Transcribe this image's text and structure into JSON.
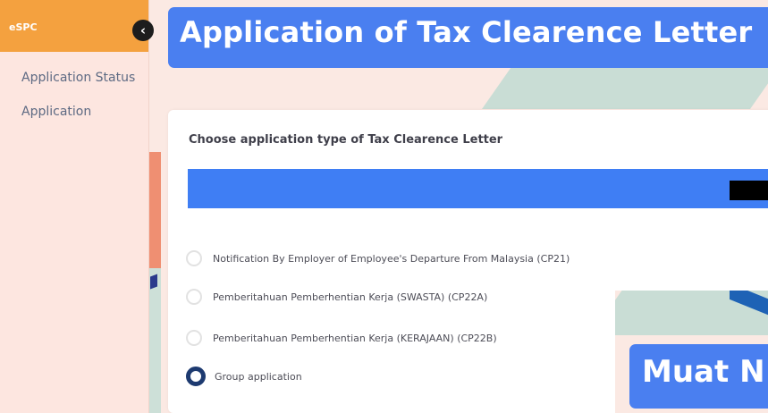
{
  "sidebar": {
    "header": "eSPC",
    "items": [
      {
        "label": "Application Status"
      },
      {
        "label": "Application"
      }
    ]
  },
  "collapse_icon": "chevron-left-icon",
  "title": "Application of Tax Clearence Letter",
  "card": {
    "prompt": "Choose application type of Tax Clearence Letter",
    "options": [
      {
        "label": "Notification By Employer of Employee's Departure From Malaysia (CP21)",
        "selected": false
      },
      {
        "label": "Pemberitahuan Pemberhentian Kerja (SWASTA) (CP22A)",
        "selected": false
      },
      {
        "label": "Pemberitahuan Pemberhentian Kerja (KERAJAAN) (CP22B)",
        "selected": false
      },
      {
        "label": "Group application",
        "selected": true
      }
    ]
  },
  "overlay": {
    "button_text": "Muat N"
  },
  "colors": {
    "accent_orange": "#f4a13f",
    "primary_blue": "#4a7ff0",
    "bar_blue": "#3f7ef4",
    "radio_selected": "#1d3a70",
    "page_bg": "#fbe9e3"
  }
}
